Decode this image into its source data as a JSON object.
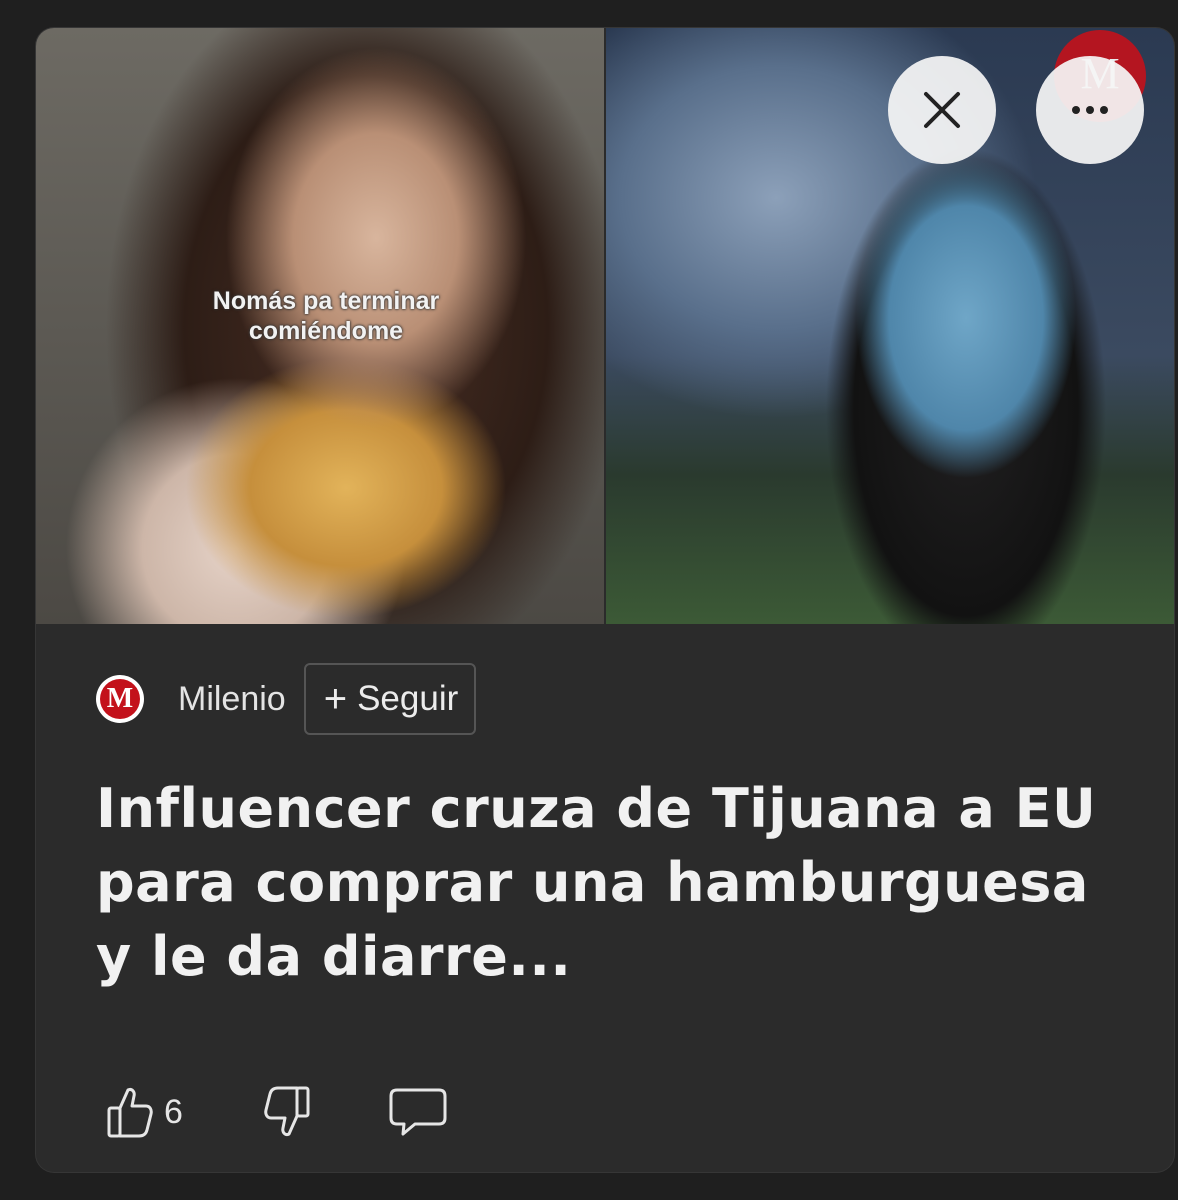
{
  "hero": {
    "caption": "Nomás pa terminar comiéndome"
  },
  "brand_corner": "M",
  "controls": {
    "close_icon": "close-icon",
    "more_icon": "more-options-icon"
  },
  "source": {
    "logo_letter": "M",
    "name": "Milenio",
    "follow_plus": "+",
    "follow_label": "Seguir"
  },
  "headline": "Influencer cruza de Tijuana a EU para comprar una hamburguesa y le da diarre...",
  "actions": {
    "like_icon": "thumbs-up-icon",
    "like_count": "6",
    "dislike_icon": "thumbs-down-icon",
    "comment_icon": "comment-icon"
  },
  "colors": {
    "card_bg": "#2b2b2b",
    "brand_red": "#c3111b",
    "text": "#f1f1f1"
  }
}
